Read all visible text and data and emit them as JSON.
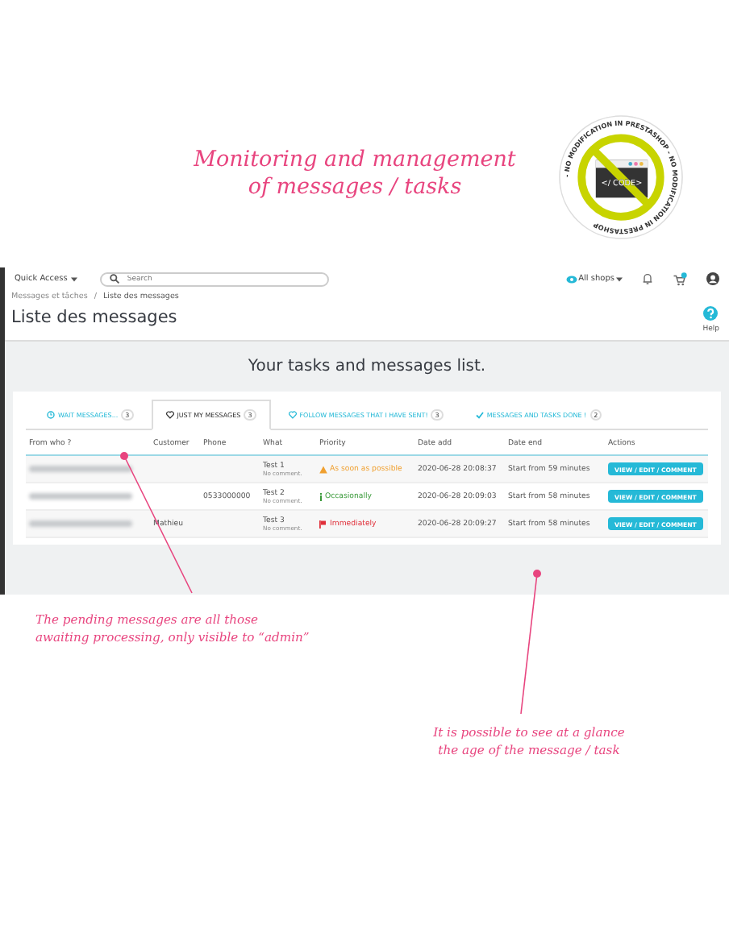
{
  "promo": {
    "title_lines": [
      "Monitoring and management",
      "of messages / tasks"
    ],
    "badge": {
      "ring_text": "- NO MODIFICATION IN PRESTASHOP - NO MODIFICATION IN PRESTASHOP",
      "code_label": "</ CODE>"
    }
  },
  "topbar": {
    "quick_access": "Quick Access",
    "search": {
      "placeholder": "Search"
    },
    "shop_selector": "All shops"
  },
  "page": {
    "breadcrumb": [
      "Messages et tâches",
      "Liste des messages"
    ],
    "breadcrumb_separator": "/",
    "title": "Liste des messages",
    "help": "Help"
  },
  "panel": {
    "heading": "Your tasks and messages list.",
    "tabs": [
      {
        "kind": "clock",
        "label": "WAIT MESSAGES...",
        "count": "3",
        "selected": false
      },
      {
        "kind": "heart",
        "label": "JUST MY MESSAGES",
        "count": "3",
        "selected": true
      },
      {
        "kind": "heart",
        "label": "FOLLOW MESSAGES THAT I HAVE SENT!",
        "count": "3",
        "selected": false
      },
      {
        "kind": "check",
        "label": "MESSAGES AND TASKS DONE !",
        "count": "2",
        "selected": false
      }
    ],
    "table": {
      "columns": [
        "From who ?",
        "Customer",
        "Phone",
        "What",
        "Priority",
        "Date add",
        "Date end",
        "Actions"
      ],
      "rows": [
        {
          "customer": "",
          "phone": "",
          "what": "Test 1",
          "note": "No comment.",
          "priority": {
            "kind": "soon",
            "label": "As soon as possible"
          },
          "date_add": "2020-06-28 20:08:37",
          "date_end": "Start from 59 minutes",
          "action": "VIEW / EDIT / COMMENT"
        },
        {
          "customer": "",
          "phone": "0533000000",
          "what": "Test 2",
          "note": "No comment.",
          "priority": {
            "kind": "occasional",
            "label": "Occasionally"
          },
          "date_add": "2020-06-28 20:09:03",
          "date_end": "Start from 58 minutes",
          "action": "VIEW / EDIT / COMMENT"
        },
        {
          "customer": "Mathieu",
          "phone": "",
          "what": "Test 3",
          "note": "No comment.",
          "priority": {
            "kind": "immediate",
            "label": "Immediately"
          },
          "date_add": "2020-06-28 20:09:27",
          "date_end": "Start from 58 minutes",
          "action": "VIEW / EDIT / COMMENT"
        }
      ]
    }
  },
  "annotations": [
    {
      "lines": [
        "The pending messages are all those",
        "awaiting processing, only visible to “admin”"
      ]
    },
    {
      "lines": [
        "It is possible to see at a glance",
        "the age of the message / task"
      ]
    }
  ]
}
